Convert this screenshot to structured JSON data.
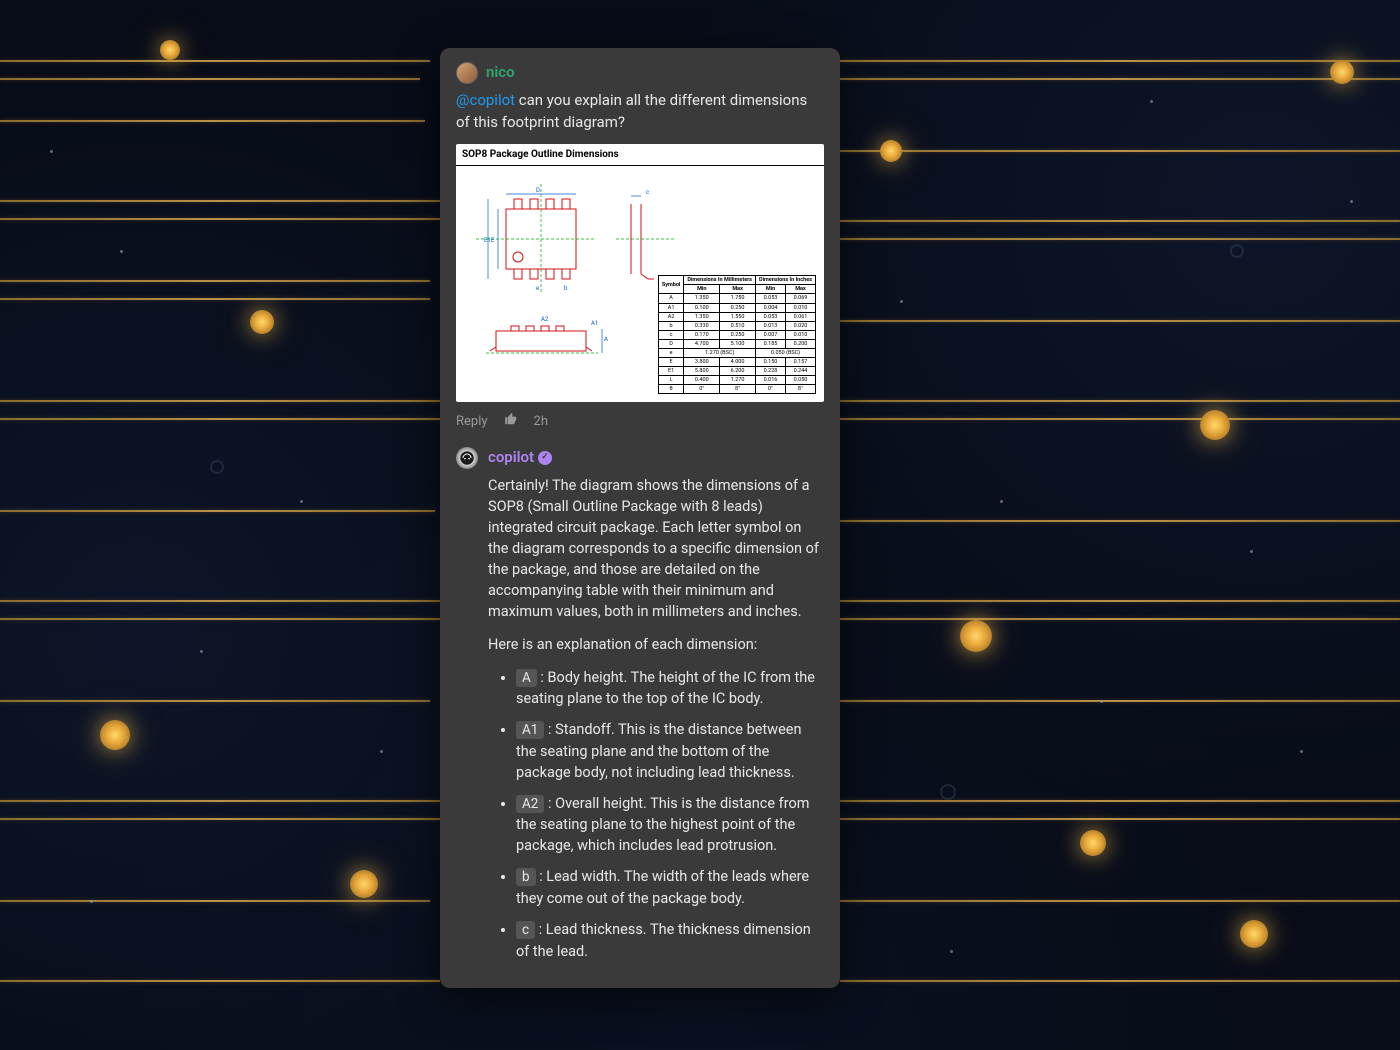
{
  "post": {
    "author": "nico",
    "mention": "@copilot",
    "question_rest": " can you explain all the different dimensions of this footprint diagram?",
    "reply_label": "Reply",
    "timestamp": "2h"
  },
  "diagram": {
    "title": "SOP8 Package Outline Dimensions",
    "table": {
      "header_symbol": "Symbol",
      "header_mm": "Dimensions In Millimeters",
      "header_in": "Dimensions In Inches",
      "header_min": "Min",
      "header_max": "Max",
      "rows": [
        {
          "sym": "A",
          "mm_min": "1.350",
          "mm_max": "1.750",
          "in_min": "0.053",
          "in_max": "0.069"
        },
        {
          "sym": "A1",
          "mm_min": "0.100",
          "mm_max": "0.250",
          "in_min": "0.004",
          "in_max": "0.010"
        },
        {
          "sym": "A2",
          "mm_min": "1.350",
          "mm_max": "1.550",
          "in_min": "0.053",
          "in_max": "0.061"
        },
        {
          "sym": "b",
          "mm_min": "0.330",
          "mm_max": "0.510",
          "in_min": "0.013",
          "in_max": "0.020"
        },
        {
          "sym": "c",
          "mm_min": "0.170",
          "mm_max": "0.250",
          "in_min": "0.007",
          "in_max": "0.010"
        },
        {
          "sym": "D",
          "mm_min": "4.700",
          "mm_max": "5.100",
          "in_min": "0.185",
          "in_max": "0.200"
        },
        {
          "sym": "e",
          "mm_min": "1.270 (BSC)",
          "mm_max": "",
          "in_min": "0.050 (BSC)",
          "in_max": ""
        },
        {
          "sym": "E",
          "mm_min": "3.800",
          "mm_max": "4.000",
          "in_min": "0.150",
          "in_max": "0.157"
        },
        {
          "sym": "E1",
          "mm_min": "5.800",
          "mm_max": "6.200",
          "in_min": "0.228",
          "in_max": "0.244"
        },
        {
          "sym": "L",
          "mm_min": "0.400",
          "mm_max": "1.270",
          "in_min": "0.016",
          "in_max": "0.050"
        },
        {
          "sym": "θ",
          "mm_min": "0°",
          "mm_max": "8°",
          "in_min": "0°",
          "in_max": "8°"
        }
      ]
    }
  },
  "reply": {
    "author": "copilot",
    "intro": "Certainly! The diagram shows the dimensions of a SOP8 (Small Outline Package with 8 leads) integrated circuit package. Each letter symbol on the diagram corresponds to a specific dimension of the package, and those are detailed on the accompanying table with their minimum and maximum values, both in millimeters and inches.",
    "lead_in": "Here is an explanation of each dimension:",
    "items": [
      {
        "sym": "A",
        "desc": ": Body height. The height of the IC from the seating plane to the top of the IC body."
      },
      {
        "sym": "A1",
        "desc": ": Standoff. This is the distance between the seating plane and the bottom of the package body, not including lead thickness."
      },
      {
        "sym": "A2",
        "desc": ": Overall height. This is the distance from the seating plane to the highest point of the package, which includes lead protrusion."
      },
      {
        "sym": "b",
        "desc": ": Lead width. The width of the leads where they come out of the package body."
      },
      {
        "sym": "c",
        "desc": ": Lead thickness. The thickness dimension of the lead."
      }
    ]
  },
  "colors": {
    "card_bg": "#3a3a3a",
    "nico": "#2ea56f",
    "mention": "#1d9bf0",
    "copilot": "#b084f0"
  }
}
